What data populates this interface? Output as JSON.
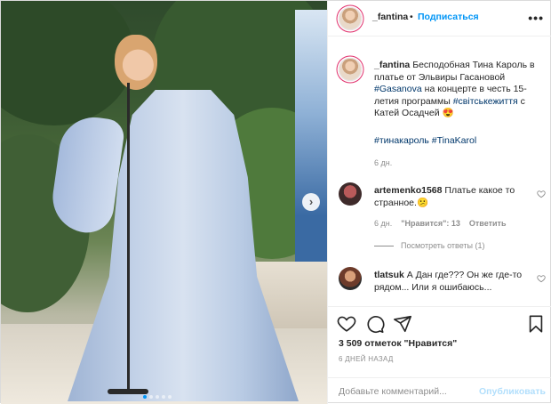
{
  "post": {
    "author": "_fantina",
    "follow_label": "Подписаться",
    "separator": "•",
    "more_label": "•••"
  },
  "caption": {
    "author": "_fantina",
    "text_1": "Бесподобная Тина Кароль в платье от Эльвиры Гасановой",
    "tag_1": "#Gasanova",
    "text_2": "на концерте в честь 15-летия программы",
    "tag_2": "#світськежиття",
    "text_3": "с Катей Осадчей",
    "emoji": "😍",
    "hashtags": "#тинакароль #TinaKarol",
    "time": "6 дн."
  },
  "comments": [
    {
      "author": "artemenko1568",
      "text": "Платье какое то странное.",
      "emoji": "😕",
      "time": "6 дн.",
      "likes": "\"Нравится\": 13",
      "reply": "Ответить"
    },
    {
      "author": "tlatsuk",
      "text": "А Дан где??? Он же где-то рядом... Или я ошибаюсь..."
    }
  ],
  "replies_label": "Посмотреть ответы (1)",
  "likes_text": "3 509 отметок \"Нравится\"",
  "ago_text": "6 ДНЕЙ НАЗАД",
  "comment_input": {
    "placeholder": "Добавьте комментарий...",
    "value": ""
  },
  "publish_label": "Опубликовать",
  "colors": {
    "accent": "#0095f6",
    "link": "#00376b",
    "muted": "#8e8e8e",
    "border": "#dbdbdb"
  },
  "icons": [
    "next-arrow-icon",
    "more-options-icon",
    "heart-icon",
    "comment-icon",
    "share-icon",
    "bookmark-icon"
  ]
}
